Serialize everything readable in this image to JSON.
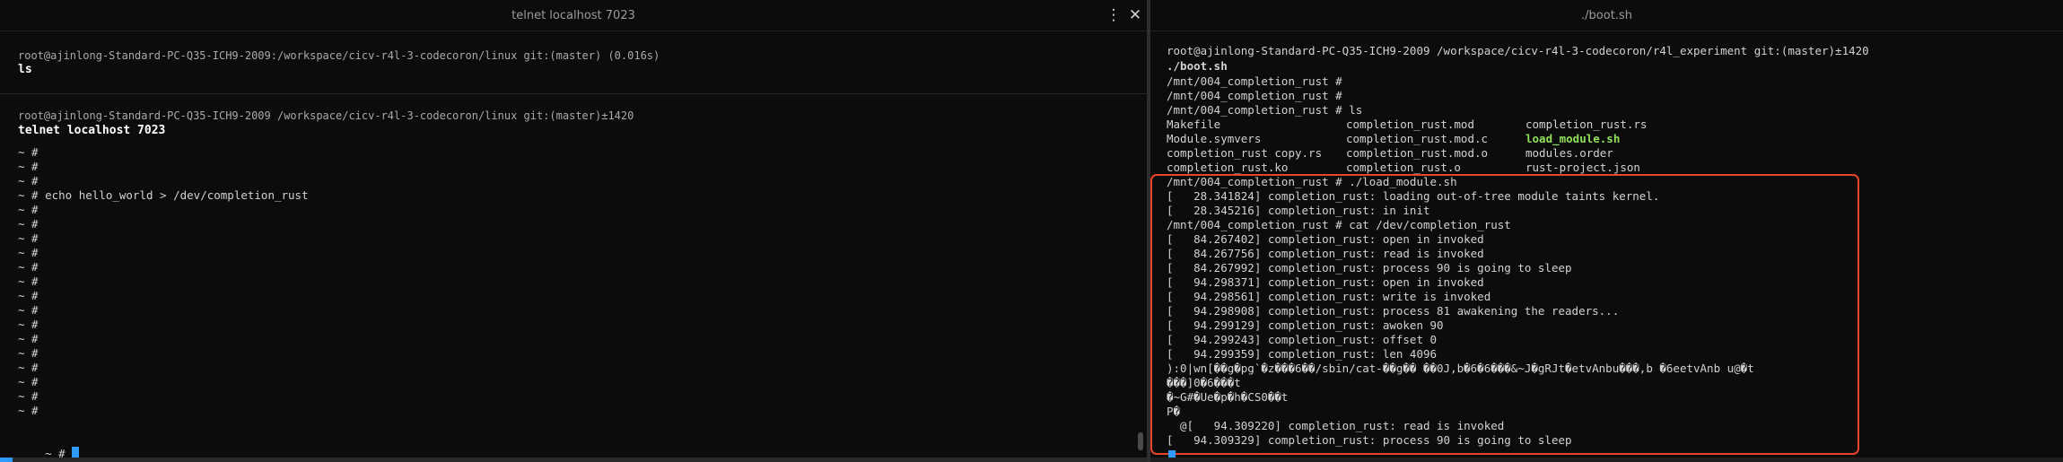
{
  "left": {
    "title": "telnet localhost 7023",
    "menu_icon": "⋮",
    "close_icon": "✕",
    "block1": {
      "prompt": "root@ajinlong-Standard-PC-Q35-ICH9-2009:/workspace/cicv-r4l-3-codecoron/linux git:(master) (0.016s)",
      "command": "ls"
    },
    "block2": {
      "prompt": "root@ajinlong-Standard-PC-Q35-ICH9-2009 /workspace/cicv-r4l-3-codecoron/linux git:(master)±1420",
      "command": "telnet localhost 7023"
    },
    "output_lines": [
      "~ #",
      "~ #",
      "~ #",
      "~ # echo hello_world > /dev/completion_rust",
      "~ #",
      "~ #",
      "~ #",
      "~ #",
      "~ #",
      "~ #",
      "~ #",
      "~ #",
      "~ #",
      "~ #",
      "~ #",
      "~ #",
      "~ #",
      "~ #",
      "~ #"
    ],
    "last_prompt": "~ # "
  },
  "right": {
    "title": "./boot.sh",
    "prompt": "root@ajinlong-Standard-PC-Q35-ICH9-2009 /workspace/cicv-r4l-3-codecoron/r4l_experiment git:(master)±1420",
    "command": "./boot.sh",
    "output_lines": [
      "/mnt/004_completion_rust #",
      "/mnt/004_completion_rust #",
      "/mnt/004_completion_rust # ls"
    ],
    "ls_rows": [
      [
        "Makefile",
        "completion_rust.mod",
        "completion_rust.rs"
      ],
      [
        "Module.symvers",
        "completion_rust.mod.c",
        "load_module.sh"
      ],
      [
        "completion_rust copy.rs",
        "completion_rust.mod.o",
        "modules.order"
      ],
      [
        "completion_rust.ko",
        "completion_rust.o",
        "rust-project.json"
      ]
    ],
    "log_lines": [
      "/mnt/004_completion_rust # ./load_module.sh",
      "[   28.341824] completion_rust: loading out-of-tree module taints kernel.",
      "[   28.345216] completion_rust: in init",
      "/mnt/004_completion_rust # cat /dev/completion_rust",
      "[   84.267402] completion_rust: open in invoked",
      "[   84.267756] completion_rust: read is invoked",
      "[   84.267992] completion_rust: process 90 is going to sleep",
      "[   94.298371] completion_rust: open in invoked",
      "[   94.298561] completion_rust: write is invoked",
      "[   94.298908] completion_rust: process 81 awakening the readers...",
      "[   94.299129] completion_rust: awoken 90",
      "[   94.299243] completion_rust: offset 0",
      "[   94.299359] completion_rust: len 4096",
      "):0|wn[��g�pg`�z���6��/sbin/cat-��g�� ��0J,b�6�6���&~J�gRJt�etvAnbu���,b �6eetvAnb u@�t",
      "���]0�6���t",
      "�~G#�Ue�p�h�CS0��t",
      "P�",
      "  @[   94.309220] completion_rust: read is invoked",
      "[   94.309329] completion_rust: process 90 is going to sleep"
    ],
    "colors": {
      "highlight_border": "#e8452b",
      "executable": "#8fe05a",
      "cursor": "#2f9bff"
    }
  }
}
